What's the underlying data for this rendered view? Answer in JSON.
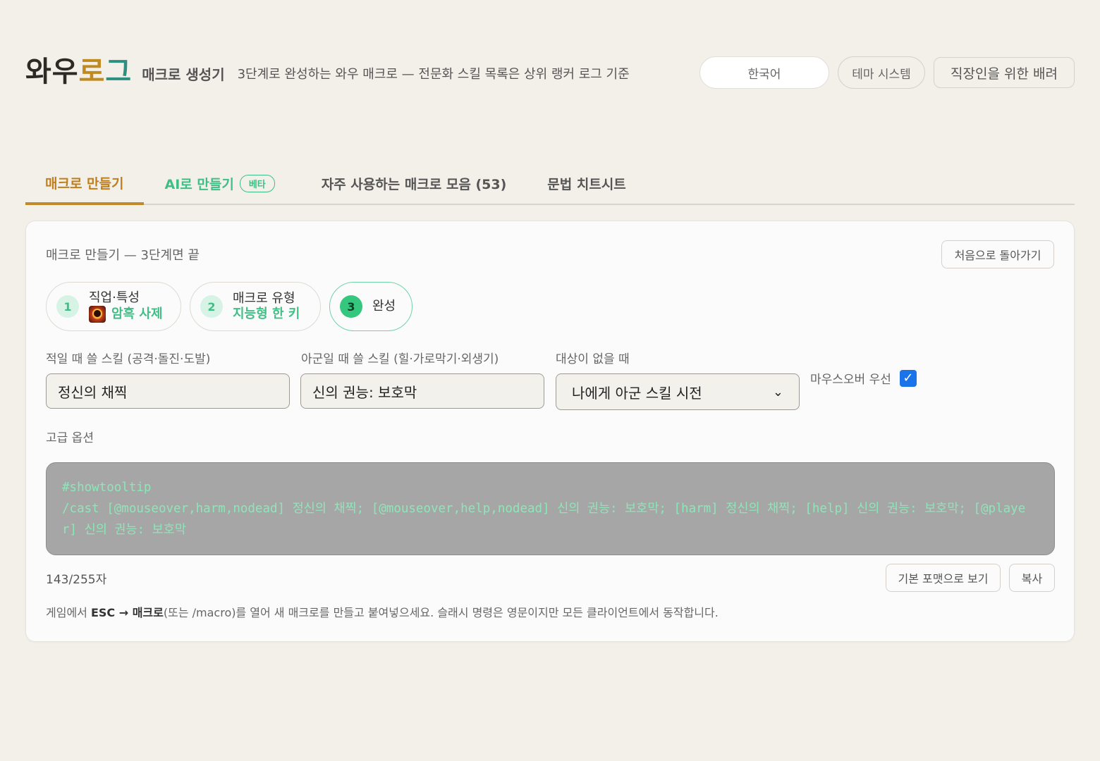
{
  "header": {
    "logo_a": "와우",
    "logo_b": "로",
    "logo_c": "그",
    "title": "매크로 생성기",
    "subtitle": "3단계로 완성하는 와우 매크로 — 전문화 스킬 목록은 상위 랭커 로그 기준",
    "language_button": "한국어",
    "theme_button": "테마 시스템",
    "worker_button": "직장인을 위한 배려"
  },
  "tabs": {
    "make": "매크로 만들기",
    "ai": "AI로 만들기",
    "ai_badge": "베타",
    "faq": "자주 사용하는 매크로 모음 (53)",
    "cheatsheet": "문법 치트시트",
    "active": "make"
  },
  "panel": {
    "title": "매크로 만들기 — 3단계면 끝",
    "restart_button": "처음으로 돌아가기",
    "steps": [
      {
        "num": "1",
        "label": "직업·특성",
        "value": "암흑 사제",
        "icon": "shadow-priest-spec-icon"
      },
      {
        "num": "2",
        "label": "매크로 유형",
        "value": "지능형 한 키"
      },
      {
        "num": "3",
        "label": "완성"
      }
    ],
    "enemy_skill_label": "적일 때 쓸 스킬 (공격·돌진·도발)",
    "enemy_skill_value": "정신의 채찍",
    "ally_skill_label": "아군일 때 쓸 스킬 (힐·가로막기·외생기)",
    "ally_skill_value": "신의 권능: 보호막",
    "no_target_label": "대상이 없을 때",
    "no_target_value": "나에게 아군 스킬 시전",
    "mouseover_label": "마우스오버 우선",
    "mouseover_checked": true,
    "advanced_label": "고급 옵션",
    "macro_text": "#showtooltip\n/cast [@mouseover,harm,nodead] 정신의 채찍; [@mouseover,help,nodead] 신의 권능: 보호막; [harm] 정신의 채찍; [help] 신의 권능: 보호막; [@player] 신의 권능: 보호막",
    "char_count": "143/255자",
    "format_button": "기본 포맷으로 보기",
    "copy_button": "복사",
    "help_prefix": "게임에서 ",
    "help_key1": "ESC → 매크로",
    "help_suffix": "(또는 /macro)를 열어 새 매크로를 만들고 붙여넣으세요. 슬래시 명령은 영문이지만 모든 클라이언트에서 동작합니다."
  },
  "colors": {
    "accent_gold": "#c08a1e",
    "accent_green": "#3fbf86",
    "checkbox_blue": "#1a73e8",
    "macro_text": "#8fe5b9"
  }
}
